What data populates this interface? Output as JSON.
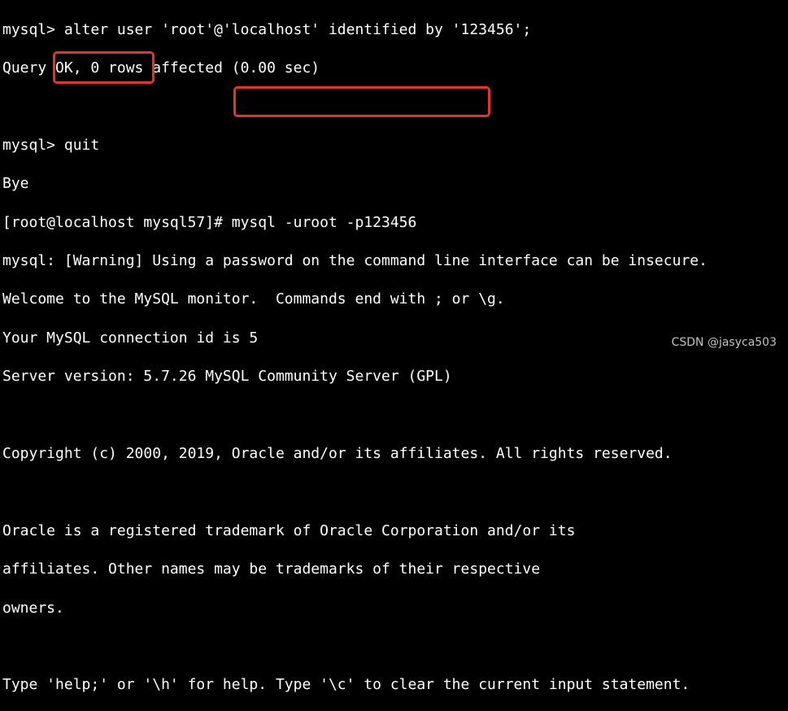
{
  "terminal": {
    "lines": [
      "mysql> alter user 'root'@'localhost' identified by '123456';",
      "Query OK, 0 rows affected (0.00 sec)",
      "",
      "mysql> quit",
      "Bye",
      "[root@localhost mysql57]# mysql -uroot -p123456",
      "mysql: [Warning] Using a password on the command line interface can be insecure.",
      "Welcome to the MySQL monitor.  Commands end with ; or \\g.",
      "Your MySQL connection id is 5",
      "Server version: 5.7.26 MySQL Community Server (GPL)",
      "",
      "Copyright (c) 2000, 2019, Oracle and/or its affiliates. All rights reserved.",
      "",
      "Oracle is a registered trademark of Oracle Corporation and/or its",
      "affiliates. Other names may be trademarks of their respective",
      "owners.",
      "",
      "Type 'help;' or '\\h' for help. Type '\\c' to clear the current input statement."
    ]
  },
  "watermark": "CSDN @jasyca503",
  "colors": {
    "background": "#000000",
    "text": "#ffffff",
    "highlight": "#e5332a"
  }
}
